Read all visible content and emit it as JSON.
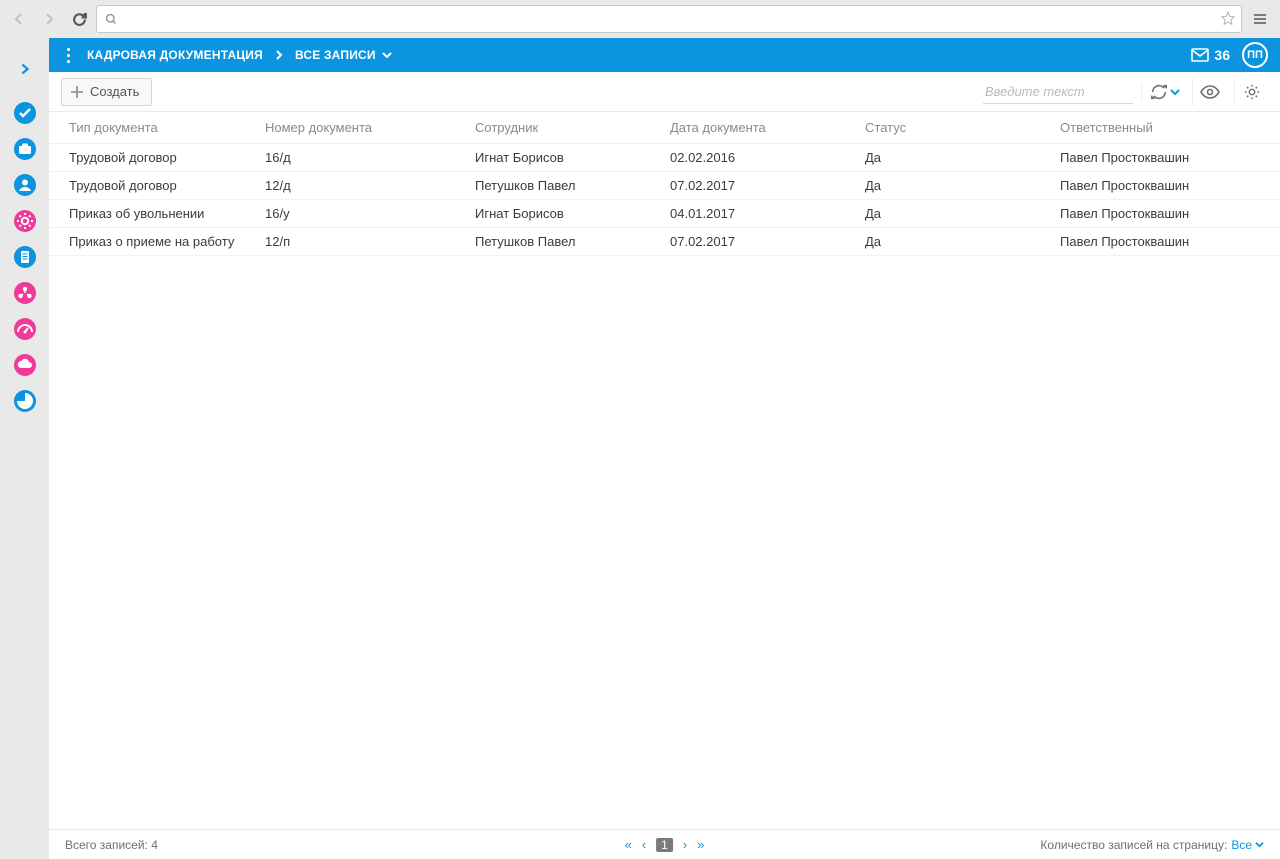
{
  "browser": {
    "url": ""
  },
  "header": {
    "crumb1": "КАДРОВАЯ ДОКУМЕНТАЦИЯ",
    "crumb2": "ВСЕ ЗАПИСИ",
    "mail_count": "36",
    "avatar": "ПП"
  },
  "toolbar": {
    "create": "Создать",
    "search_placeholder": "Введите текст"
  },
  "columns": {
    "type": "Тип документа",
    "number": "Номер документа",
    "employee": "Сотрудник",
    "date": "Дата документа",
    "status": "Статус",
    "responsible": "Ответственный"
  },
  "rows": [
    {
      "type": "Трудовой договор",
      "number": "16/д",
      "employee": "Игнат Борисов",
      "date": "02.02.2016",
      "status": "Да",
      "responsible": "Павел Простоквашин"
    },
    {
      "type": "Трудовой договор",
      "number": "12/д",
      "employee": "Петушков Павел",
      "date": "07.02.2017",
      "status": "Да",
      "responsible": "Павел Простоквашин"
    },
    {
      "type": "Приказ об увольнении",
      "number": "16/у",
      "employee": "Игнат Борисов",
      "date": "04.01.2017",
      "status": "Да",
      "responsible": "Павел Простоквашин"
    },
    {
      "type": "Приказ о приеме на работу",
      "number": "12/п",
      "employee": "Петушков Павел",
      "date": "07.02.2017",
      "status": "Да",
      "responsible": "Павел Простоквашин"
    }
  ],
  "footer": {
    "total_label": "Всего записей:",
    "total_count": "4",
    "page": "1",
    "perpage_label": "Количество записей на страницу:",
    "perpage_value": "Все"
  },
  "rail": {
    "items": [
      "expand",
      "check",
      "briefcase",
      "person",
      "gear",
      "doc",
      "org",
      "gauge",
      "cloud",
      "chart"
    ]
  },
  "colors": {
    "accent": "#0d94e0",
    "pink": "#ef3a9a"
  }
}
